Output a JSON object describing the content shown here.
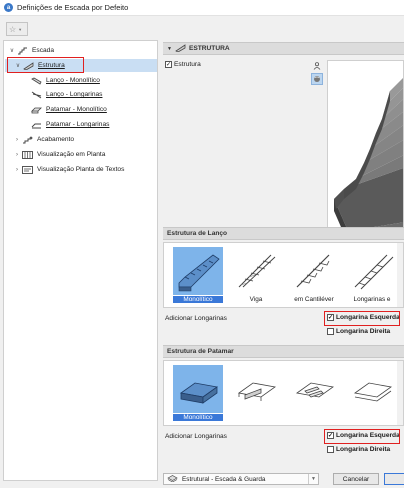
{
  "window": {
    "title": "Definições de Escada por Defeito"
  },
  "tree": {
    "items": [
      {
        "label": "Escada",
        "icon": "stair-icon"
      },
      {
        "label": "Estrutura",
        "icon": "structure-icon"
      },
      {
        "label": "Lanço - Monolítico",
        "icon": "flight-monolithic-icon"
      },
      {
        "label": "Lanço - Longarinas",
        "icon": "flight-stringers-icon"
      },
      {
        "label": "Patamar - Monolítico",
        "icon": "landing-monolithic-icon"
      },
      {
        "label": "Patamar - Longarinas",
        "icon": "landing-stringers-icon"
      },
      {
        "label": "Acabamento",
        "icon": "finish-icon"
      },
      {
        "label": "Visualização em Planta",
        "icon": "plan-view-icon"
      },
      {
        "label": "Visualização Planta de Textos",
        "icon": "plan-text-icon"
      }
    ]
  },
  "panel": {
    "header": "ESTRUTURA",
    "estrutura_checkbox": {
      "label": "Estrutura",
      "checked": true
    }
  },
  "flight_structure": {
    "header": "Estrutura de Lanço",
    "options": [
      {
        "label": "Monolítico",
        "selected": true
      },
      {
        "label": "Viga",
        "selected": false
      },
      {
        "label": "em Cantiléver",
        "selected": false
      },
      {
        "label": "Longarinas e",
        "selected": false
      }
    ],
    "add_label": "Adicionar Longarinas",
    "left": {
      "label": "Longarina Esquerda",
      "checked": true
    },
    "right": {
      "label": "Longarina Direita",
      "checked": false
    }
  },
  "landing_structure": {
    "header": "Estrutura de Patamar",
    "options": [
      {
        "label": "Monolítico",
        "selected": true
      },
      {
        "label": "",
        "selected": false
      },
      {
        "label": "",
        "selected": false
      },
      {
        "label": "",
        "selected": false
      }
    ],
    "add_label": "Adicionar Longarinas",
    "left": {
      "label": "Longarina Esquerda",
      "checked": true
    },
    "right": {
      "label": "Longarina Direita",
      "checked": false
    }
  },
  "footer": {
    "dropdown_value": "Estrutural - Escada & Guarda",
    "cancel_label": "Cancelar"
  },
  "colors": {
    "accent": "#3a78d8",
    "selection": "#c9def3",
    "highlight": "#e02020"
  }
}
